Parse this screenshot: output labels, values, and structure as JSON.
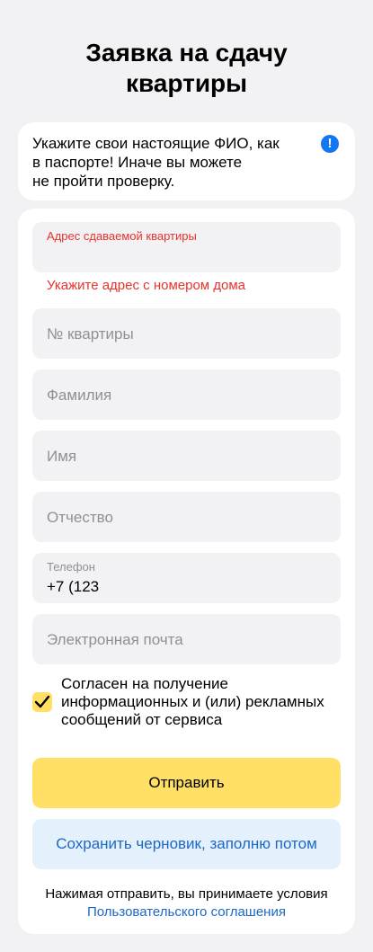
{
  "page": {
    "title_line1": "Заявка на сдачу",
    "title_line2": "квартиры"
  },
  "notice": {
    "text_line1": "Укажите свои настоящие ФИО, как",
    "text_line2": "в паспорте! Иначе вы можете",
    "text_line3": "не пройти проверку.",
    "icon": "info-icon",
    "icon_glyph": "!"
  },
  "form": {
    "address": {
      "label": "Адрес сдаваемой квартиры",
      "error": "Укажите адрес с номером дома",
      "value": ""
    },
    "apartment": {
      "placeholder": "№ квартиры"
    },
    "surname": {
      "placeholder": "Фамилия"
    },
    "name": {
      "placeholder": "Имя"
    },
    "patronymic": {
      "placeholder": "Отчество"
    },
    "phone": {
      "label": "Телефон",
      "value": "+7 (123"
    },
    "email": {
      "placeholder": "Электронная почта"
    },
    "consent": {
      "checked": true,
      "text_line1": "Согласен на получение",
      "text_line2": "информационных и (или) рекламных",
      "text_line3": "сообщений от сервиса"
    },
    "submit_label": "Отправить",
    "draft_label": "Сохранить черновик, заполню потом",
    "footer_text": "Нажимая отправить, вы принимаете условия",
    "footer_link": "Пользовательского соглашения"
  },
  "colors": {
    "accent_yellow": "#ffe065",
    "link_blue": "#1c68c4",
    "error_red": "#e8322b",
    "info_blue": "#1577f0"
  }
}
